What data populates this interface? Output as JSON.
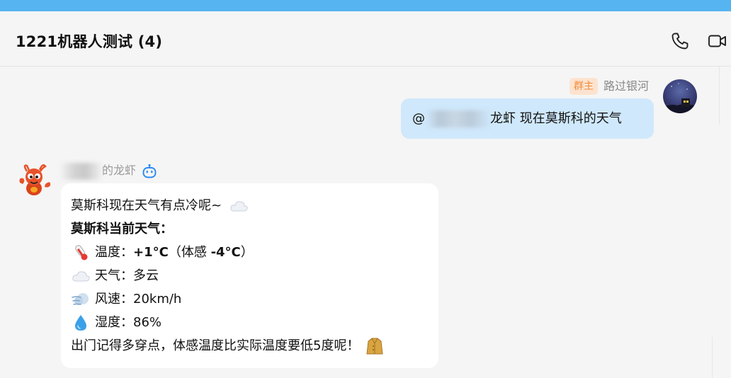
{
  "header": {
    "title": "1221机器人测试 (4)",
    "phone_icon": "phone-icon",
    "video_icon": "video-camera-icon"
  },
  "outgoing": {
    "badge": "群主",
    "sender": "路过银河",
    "mention": "@",
    "text": "龙虾 现在莫斯科的天气"
  },
  "incoming": {
    "sender_suffix": "的龙虾",
    "bot_icon": "robot-icon",
    "intro": "莫斯科现在天气有点冷呢~",
    "heading": "莫斯科当前天气：",
    "temp_label": "温度：",
    "temp_value": "+1°C",
    "feel_open": "（体感 ",
    "feel_value": "-4°C",
    "feel_close": "）",
    "weather_label": "天气：",
    "weather_value": "多云",
    "wind_label": "风速：",
    "wind_value": "20km/h",
    "humidity_label": "湿度：",
    "humidity_value": "86%",
    "closing": "出门记得多穿点，体感温度比实际温度要低5度呢！"
  },
  "colors": {
    "top_bar": "#56b4f0",
    "outgoing_bubble": "#cfe8fb",
    "badge_bg": "#fde3cf",
    "badge_text": "#f08c3b",
    "bot_icon": "#2a8bf2"
  }
}
